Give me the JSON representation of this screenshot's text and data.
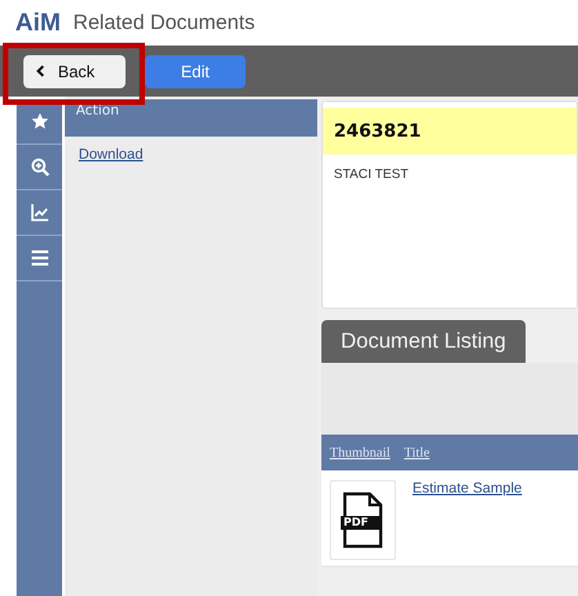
{
  "app": {
    "logo": "AiM",
    "title": "Related Documents"
  },
  "toolbar": {
    "buttons": [
      {
        "label": "Back",
        "kind": "back",
        "highlighted": true
      },
      {
        "label": "Edit",
        "kind": "primary",
        "highlighted": false
      }
    ]
  },
  "nav": [
    {
      "kind": "star"
    },
    {
      "kind": "zoom"
    },
    {
      "kind": "chart"
    },
    {
      "kind": "menu"
    }
  ],
  "action_panel": {
    "header": "Action",
    "links": [
      "Download"
    ]
  },
  "record": {
    "id": "2463821",
    "description": "STACI TEST"
  },
  "listing": {
    "tab": "Document Listing",
    "columns": [
      "Thumbnail",
      "Title"
    ],
    "rows": [
      {
        "thumbnail": "PDF",
        "title": "Estimate Sample"
      }
    ]
  }
}
